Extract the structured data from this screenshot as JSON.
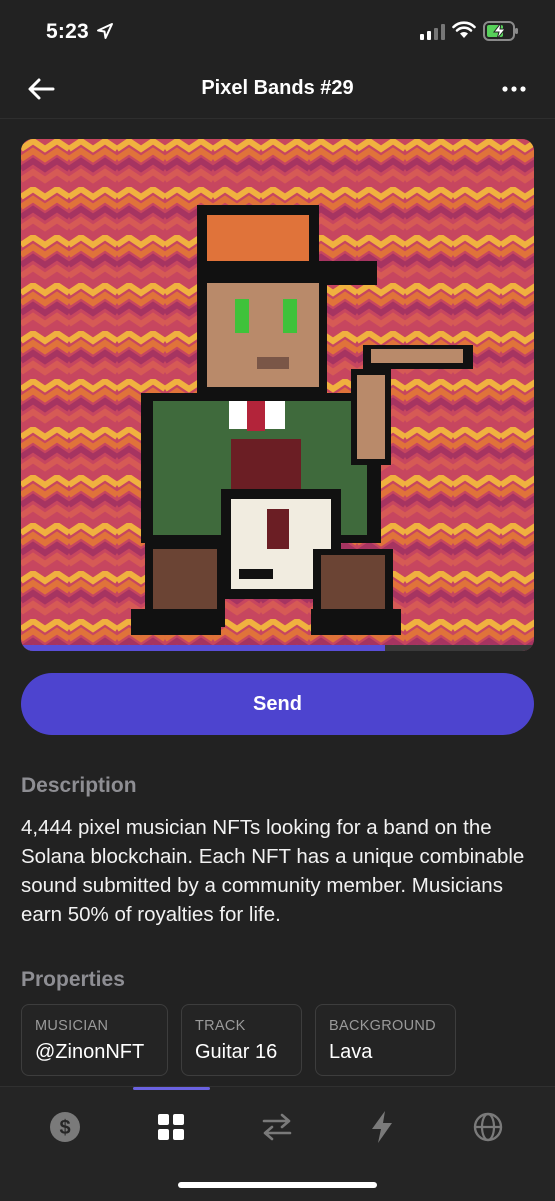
{
  "status_bar": {
    "time": "5:23"
  },
  "header": {
    "title": "Pixel Bands #29"
  },
  "nft": {
    "progress": 0.71
  },
  "actions": {
    "send_label": "Send"
  },
  "description": {
    "label": "Description",
    "text": "4,444 pixel musician NFTs looking for a band on the Solana blockchain. Each NFT has a unique combinable sound submitted by a community member. Musicians earn 50% of royalties for life."
  },
  "properties": {
    "label": "Properties",
    "items": [
      {
        "key": "MUSICIAN",
        "value": "@ZinonNFT"
      },
      {
        "key": "TRACK",
        "value": "Guitar 16"
      },
      {
        "key": "BACKGROUND",
        "value": "Lava"
      }
    ]
  },
  "tab_bar": {
    "tabs": [
      {
        "icon": "dollar-icon"
      },
      {
        "icon": "grid-icon",
        "active": true
      },
      {
        "icon": "swap-icon"
      },
      {
        "icon": "lightning-icon"
      },
      {
        "icon": "globe-icon"
      }
    ]
  },
  "colors": {
    "background": "#222222",
    "accent": "#4d44cf",
    "muted_text": "#8e8e93"
  }
}
